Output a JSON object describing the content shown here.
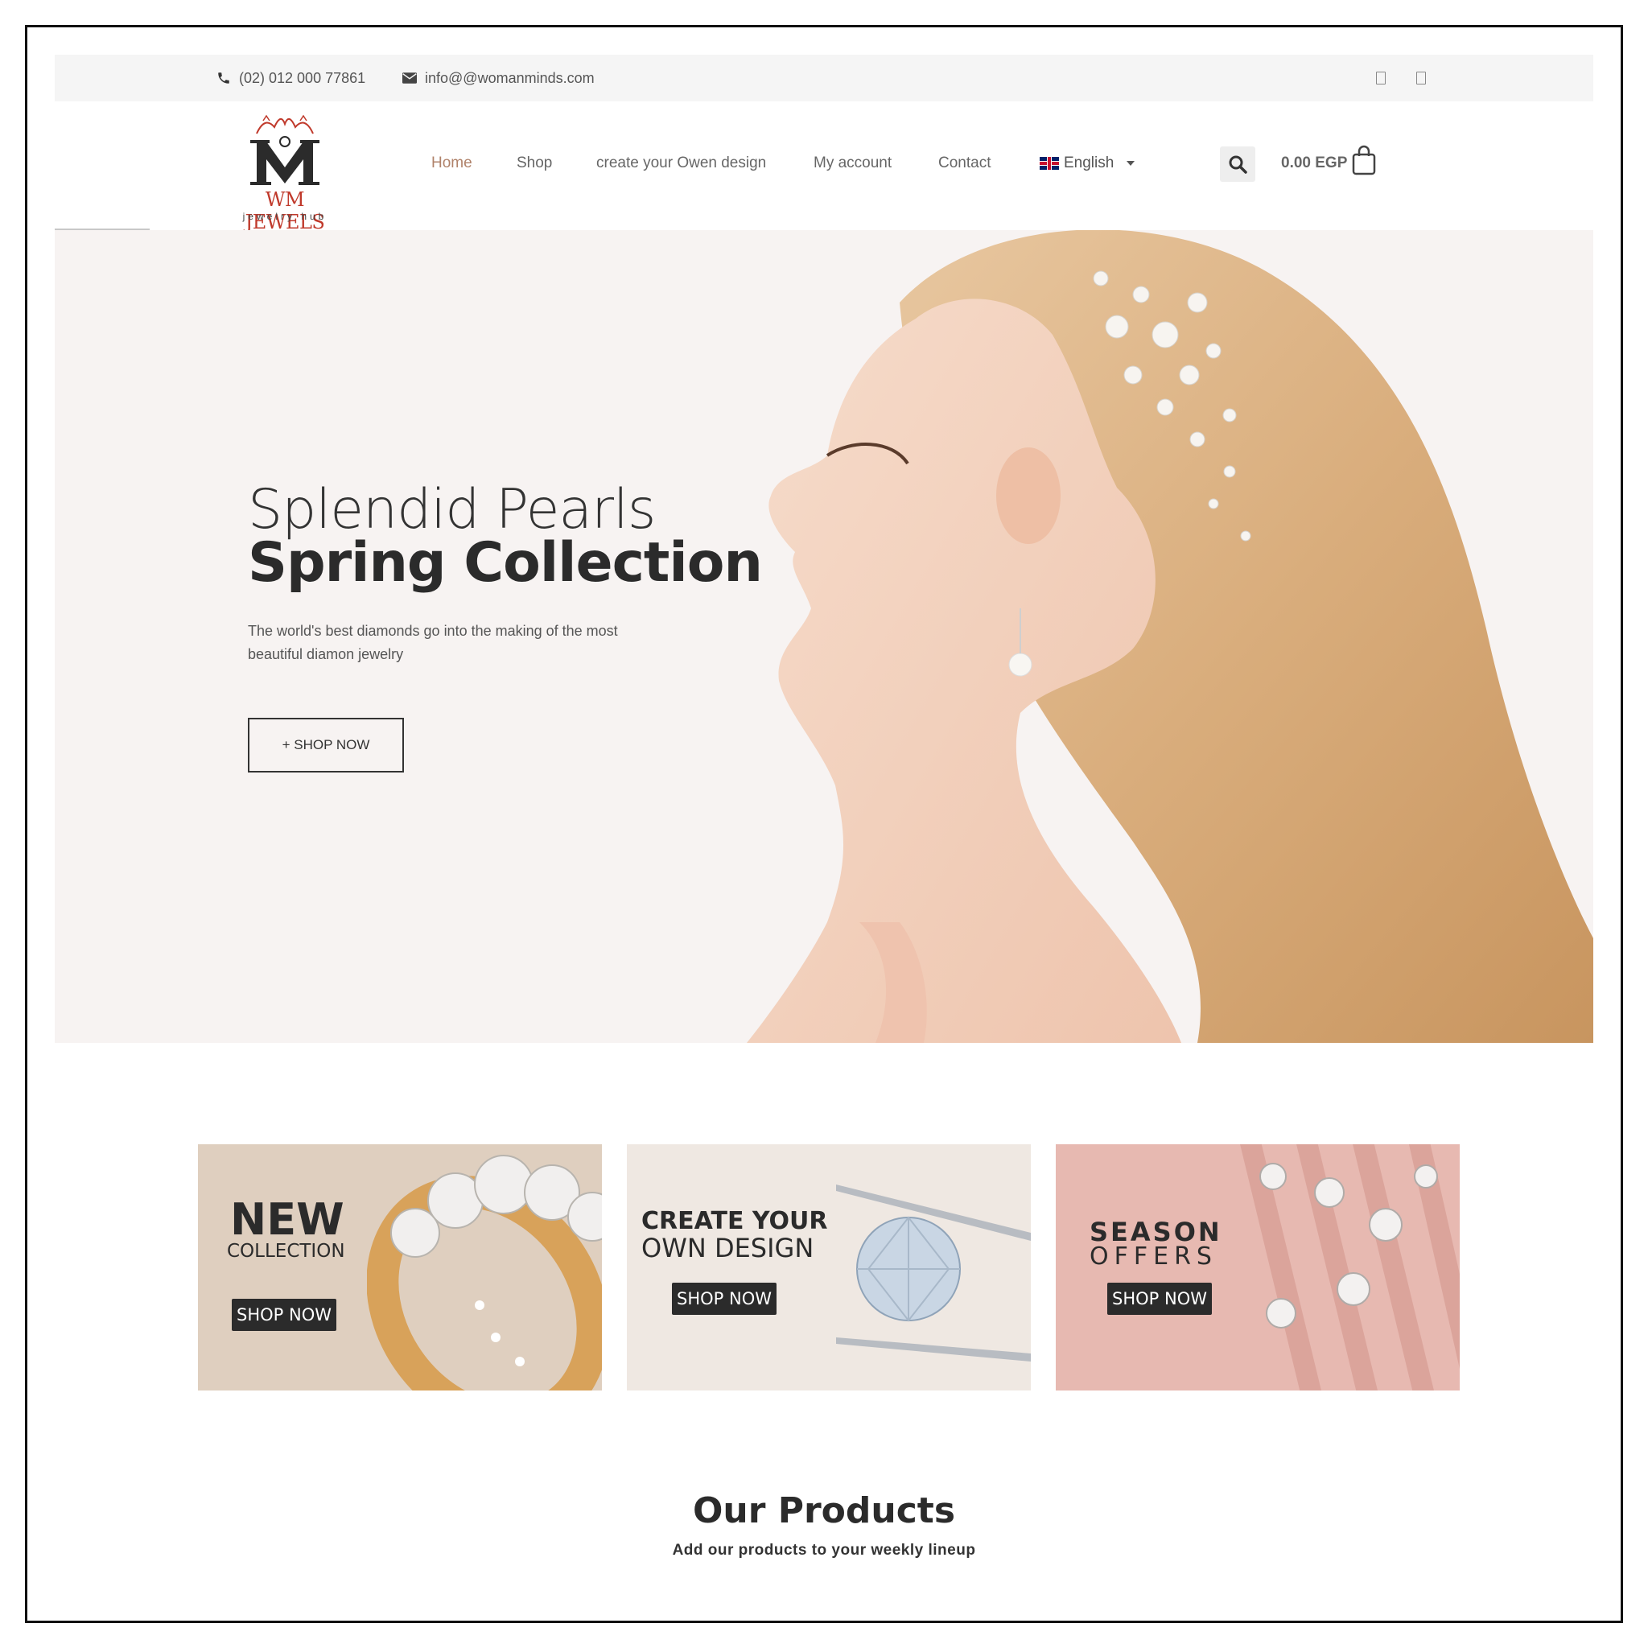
{
  "topbar": {
    "phone": "(02) 012 000 77861",
    "email": "info@@womanminds.com",
    "social_icons": [
      "social-icon-1",
      "social-icon-2"
    ]
  },
  "logo": {
    "name": "WM JEWELS",
    "tagline": "jewelry hub"
  },
  "nav": {
    "items": [
      {
        "label": "Home",
        "active": true
      },
      {
        "label": "Shop"
      },
      {
        "label": "create your Owen design"
      },
      {
        "label": "My account"
      },
      {
        "label": "Contact"
      }
    ],
    "language": "English"
  },
  "cart": {
    "total": "0.00 EGP"
  },
  "hero": {
    "title_light": "Splendid Pearls",
    "title_bold": "Spring Collection",
    "description": "The world's best diamonds go into the making of the most beautiful diamon jewelry",
    "button": "+ SHOP NOW"
  },
  "banners": [
    {
      "line1": "NEW",
      "line2": "COLLECTION",
      "button": "SHOP NOW",
      "bg": "#dfcfbf"
    },
    {
      "line1": "CREATE YOUR",
      "line2": "OWN DESIGN",
      "button": "SHOP NOW",
      "bg": "#efe8e2"
    },
    {
      "line1": "SEASON",
      "line2": "OFFERS",
      "button": "SHOP NOW",
      "bg": "#e7b9b1"
    }
  ],
  "products": {
    "title": "Our Products",
    "subtitle": "Add our products to your weekly lineup"
  },
  "colors": {
    "accent": "#b0826a",
    "logo_red": "#c0392b",
    "dark": "#2b2b2b"
  }
}
